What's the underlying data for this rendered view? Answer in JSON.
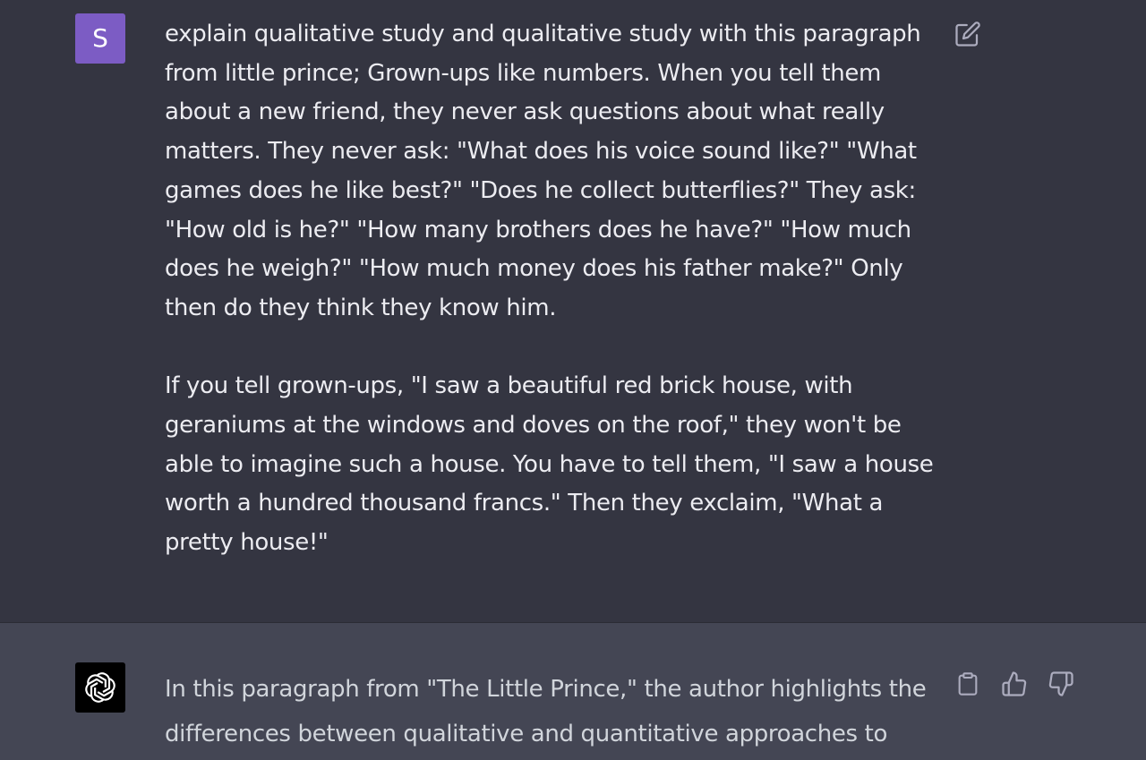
{
  "user_message": {
    "avatar_letter": "S",
    "avatar_color": "#7c5cc4",
    "paragraph_1_lines": [
      "explain qualitative study and qualitative study with this paragraph",
      "from little prince; Grown-ups like numbers. When you tell them",
      "about a new friend, they never ask questions about what really",
      "matters. They never ask: \"What does his voice sound like?\" \"What",
      "games does he like best?\" \"Does he collect butterflies?\" They ask:",
      "\"How old is he?\" \"How many brothers does he have?\" \"How much",
      "does he weigh?\" \"How much money does his father make?\" Only",
      "then do they think they know him."
    ],
    "paragraph_2_lines": [
      "If you tell grown-ups, \"I saw a beautiful red brick house, with",
      "geraniums at the windows and doves on the roof,\" they won't be",
      "able to imagine such a house. You have to tell them, \"I saw a house",
      "worth a hundred thousand francs.\" Then they exclaim, \"What a",
      "pretty house!\""
    ],
    "actions": {
      "edit_icon": "edit-icon"
    }
  },
  "assistant_message": {
    "avatar_icon": "openai-logo-icon",
    "lines": [
      "In this paragraph from \"The Little Prince,\" the author highlights the",
      "differences between qualitative and quantitative approaches to"
    ],
    "actions": {
      "copy_icon": "clipboard-icon",
      "thumbs_up_icon": "thumbs-up-icon",
      "thumbs_down_icon": "thumbs-down-icon"
    }
  },
  "colors": {
    "user_bg": "#343541",
    "assistant_bg": "#444654",
    "user_text": "#ececf1",
    "assistant_text": "#d1d5db",
    "icon": "#acacbe"
  }
}
